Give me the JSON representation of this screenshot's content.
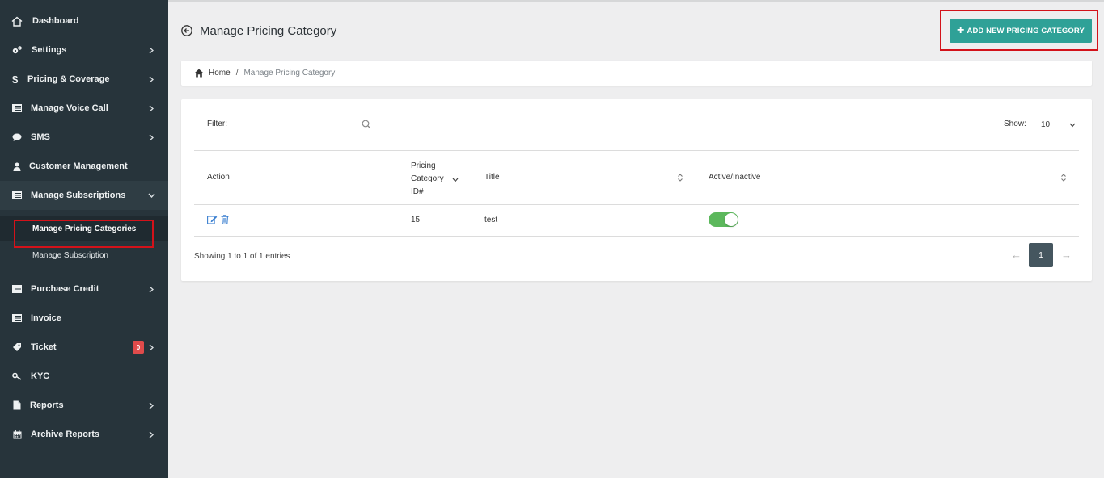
{
  "sidebar": {
    "items": [
      {
        "label": "Dashboard",
        "icon": "home-icon",
        "has_chevron": false
      },
      {
        "label": "Settings",
        "icon": "gears-icon",
        "has_chevron": true
      },
      {
        "label": "Pricing & Coverage",
        "icon": "dollar-icon",
        "has_chevron": true
      },
      {
        "label": "Manage Voice Call",
        "icon": "list-icon",
        "has_chevron": true
      },
      {
        "label": "SMS",
        "icon": "comment-icon",
        "has_chevron": true
      },
      {
        "label": "Customer Management",
        "icon": "user-icon",
        "has_chevron": false
      },
      {
        "label": "Manage Subscriptions",
        "icon": "list-icon",
        "has_chevron": true,
        "expanded": true
      },
      {
        "label": "Purchase Credit",
        "icon": "list-icon",
        "has_chevron": true
      },
      {
        "label": "Invoice",
        "icon": "list-icon",
        "has_chevron": false
      },
      {
        "label": "Ticket",
        "icon": "ticket-icon",
        "has_chevron": true,
        "badge": "0"
      },
      {
        "label": "KYC",
        "icon": "key-icon",
        "has_chevron": false
      },
      {
        "label": "Reports",
        "icon": "file-icon",
        "has_chevron": true
      },
      {
        "label": "Archive Reports",
        "icon": "calendar-icon",
        "has_chevron": true
      }
    ],
    "submenu": [
      {
        "label": "Manage Pricing Categories",
        "selected": true
      },
      {
        "label": "Manage Subscription",
        "selected": false
      }
    ]
  },
  "header": {
    "title": "Manage Pricing Category",
    "add_button_label": "ADD NEW PRICING CATEGORY"
  },
  "breadcrumb": {
    "home": "Home",
    "separator": "/",
    "current": "Manage Pricing Category"
  },
  "table": {
    "filter_label": "Filter:",
    "filter_value": "",
    "show_label": "Show:",
    "show_value": "10",
    "columns": {
      "action": "Action",
      "id_line1": "Pricing",
      "id_line2": "Category",
      "id_line3": "ID#",
      "title": "Title",
      "active": "Active/Inactive"
    },
    "rows": [
      {
        "id": "15",
        "title": "test",
        "active": true
      }
    ],
    "summary": "Showing 1 to 1 of 1 entries",
    "pagination": {
      "prev": "←",
      "current_page": "1",
      "next": "→"
    }
  },
  "colors": {
    "sidebar_bg": "#27343b",
    "accent": "#2fa197",
    "toggle_on": "#5cb85c",
    "highlight_box": "#d3121a",
    "badge": "#e04b4b"
  }
}
